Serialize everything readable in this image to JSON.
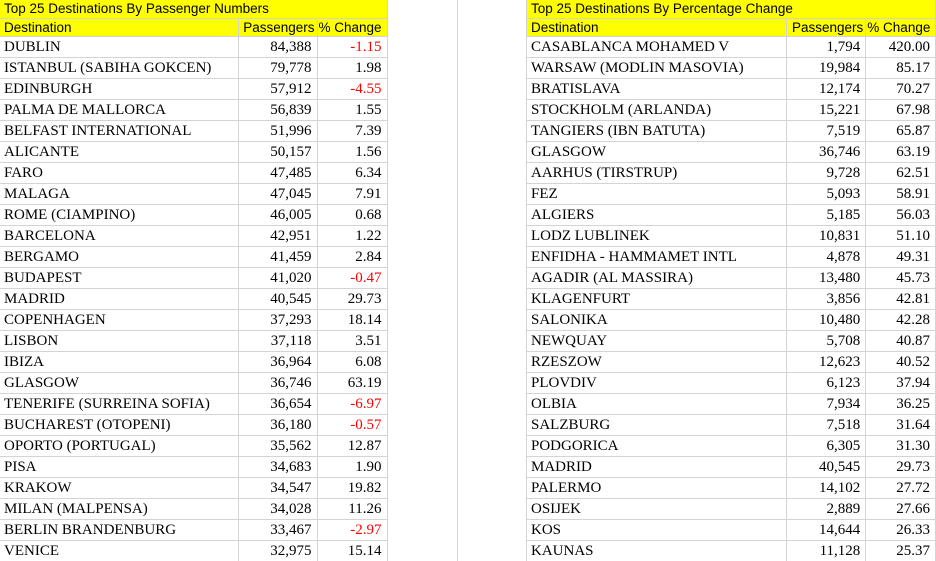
{
  "left_table": {
    "title": "Top 25 Destinations By Passenger Numbers",
    "headers": {
      "destination": "Destination",
      "passengers": "Passengers",
      "change": "% Change"
    },
    "rows": [
      {
        "destination": "DUBLIN",
        "passengers": "84,388",
        "change": "-1.15",
        "negative": true
      },
      {
        "destination": "ISTANBUL (SABIHA GOKCEN)",
        "passengers": "79,778",
        "change": "1.98",
        "negative": false
      },
      {
        "destination": "EDINBURGH",
        "passengers": "57,912",
        "change": "-4.55",
        "negative": true
      },
      {
        "destination": "PALMA DE MALLORCA",
        "passengers": "56,839",
        "change": "1.55",
        "negative": false
      },
      {
        "destination": "BELFAST INTERNATIONAL",
        "passengers": "51,996",
        "change": "7.39",
        "negative": false
      },
      {
        "destination": "ALICANTE",
        "passengers": "50,157",
        "change": "1.56",
        "negative": false
      },
      {
        "destination": "FARO",
        "passengers": "47,485",
        "change": "6.34",
        "negative": false
      },
      {
        "destination": "MALAGA",
        "passengers": "47,045",
        "change": "7.91",
        "negative": false
      },
      {
        "destination": "ROME (CIAMPINO)",
        "passengers": "46,005",
        "change": "0.68",
        "negative": false
      },
      {
        "destination": "BARCELONA",
        "passengers": "42,951",
        "change": "1.22",
        "negative": false
      },
      {
        "destination": "BERGAMO",
        "passengers": "41,459",
        "change": "2.84",
        "negative": false
      },
      {
        "destination": "BUDAPEST",
        "passengers": "41,020",
        "change": "-0.47",
        "negative": true
      },
      {
        "destination": "MADRID",
        "passengers": "40,545",
        "change": "29.73",
        "negative": false
      },
      {
        "destination": "COPENHAGEN",
        "passengers": "37,293",
        "change": "18.14",
        "negative": false
      },
      {
        "destination": "LISBON",
        "passengers": "37,118",
        "change": "3.51",
        "negative": false
      },
      {
        "destination": "IBIZA",
        "passengers": "36,964",
        "change": "6.08",
        "negative": false
      },
      {
        "destination": "GLASGOW",
        "passengers": "36,746",
        "change": "63.19",
        "negative": false
      },
      {
        "destination": "TENERIFE (SURREINA SOFIA)",
        "passengers": "36,654",
        "change": "-6.97",
        "negative": true
      },
      {
        "destination": "BUCHAREST (OTOPENI)",
        "passengers": "36,180",
        "change": "-0.57",
        "negative": true
      },
      {
        "destination": "OPORTO (PORTUGAL)",
        "passengers": "35,562",
        "change": "12.87",
        "negative": false
      },
      {
        "destination": "PISA",
        "passengers": "34,683",
        "change": "1.90",
        "negative": false
      },
      {
        "destination": "KRAKOW",
        "passengers": "34,547",
        "change": "19.82",
        "negative": false
      },
      {
        "destination": "MILAN (MALPENSA)",
        "passengers": "34,028",
        "change": "11.26",
        "negative": false
      },
      {
        "destination": "BERLIN BRANDENBURG",
        "passengers": "33,467",
        "change": "-2.97",
        "negative": true
      },
      {
        "destination": "VENICE",
        "passengers": "32,975",
        "change": "15.14",
        "negative": false
      }
    ]
  },
  "right_table": {
    "title": "Top 25 Destinations By Percentage Change",
    "headers": {
      "destination": "Destination",
      "passengers": "Passengers",
      "change": "% Change"
    },
    "rows": [
      {
        "destination": "CASABLANCA MOHAMED V",
        "passengers": "1,794",
        "change": "420.00",
        "negative": false
      },
      {
        "destination": "WARSAW (MODLIN MASOVIA)",
        "passengers": "19,984",
        "change": "85.17",
        "negative": false
      },
      {
        "destination": "BRATISLAVA",
        "passengers": "12,174",
        "change": "70.27",
        "negative": false
      },
      {
        "destination": "STOCKHOLM (ARLANDA)",
        "passengers": "15,221",
        "change": "67.98",
        "negative": false
      },
      {
        "destination": "TANGIERS (IBN BATUTA)",
        "passengers": "7,519",
        "change": "65.87",
        "negative": false
      },
      {
        "destination": "GLASGOW",
        "passengers": "36,746",
        "change": "63.19",
        "negative": false
      },
      {
        "destination": "AARHUS (TIRSTRUP)",
        "passengers": "9,728",
        "change": "62.51",
        "negative": false
      },
      {
        "destination": "FEZ",
        "passengers": "5,093",
        "change": "58.91",
        "negative": false
      },
      {
        "destination": "ALGIERS",
        "passengers": "5,185",
        "change": "56.03",
        "negative": false
      },
      {
        "destination": "LODZ LUBLINEK",
        "passengers": "10,831",
        "change": "51.10",
        "negative": false
      },
      {
        "destination": "ENFIDHA - HAMMAMET INTL",
        "passengers": "4,878",
        "change": "49.31",
        "negative": false
      },
      {
        "destination": "AGADIR (AL MASSIRA)",
        "passengers": "13,480",
        "change": "45.73",
        "negative": false
      },
      {
        "destination": "KLAGENFURT",
        "passengers": "3,856",
        "change": "42.81",
        "negative": false
      },
      {
        "destination": "SALONIKA",
        "passengers": "10,480",
        "change": "42.28",
        "negative": false
      },
      {
        "destination": "NEWQUAY",
        "passengers": "5,708",
        "change": "40.87",
        "negative": false
      },
      {
        "destination": "RZESZOW",
        "passengers": "12,623",
        "change": "40.52",
        "negative": false
      },
      {
        "destination": "PLOVDIV",
        "passengers": "6,123",
        "change": "37.94",
        "negative": false
      },
      {
        "destination": "OLBIA",
        "passengers": "7,934",
        "change": "36.25",
        "negative": false
      },
      {
        "destination": "SALZBURG",
        "passengers": "7,518",
        "change": "31.64",
        "negative": false
      },
      {
        "destination": "PODGORICA",
        "passengers": "6,305",
        "change": "31.30",
        "negative": false
      },
      {
        "destination": "MADRID",
        "passengers": "40,545",
        "change": "29.73",
        "negative": false
      },
      {
        "destination": "PALERMO",
        "passengers": "14,102",
        "change": "27.72",
        "negative": false
      },
      {
        "destination": "OSIJEK",
        "passengers": "2,889",
        "change": "27.66",
        "negative": false
      },
      {
        "destination": "KOS",
        "passengers": "14,644",
        "change": "26.33",
        "negative": false
      },
      {
        "destination": "KAUNAS",
        "passengers": "11,128",
        "change": "25.37",
        "negative": false
      }
    ]
  },
  "colors": {
    "header_fill": "#ffff00",
    "negative_text": "#ff0000",
    "gridline": "#d4d4d4"
  }
}
